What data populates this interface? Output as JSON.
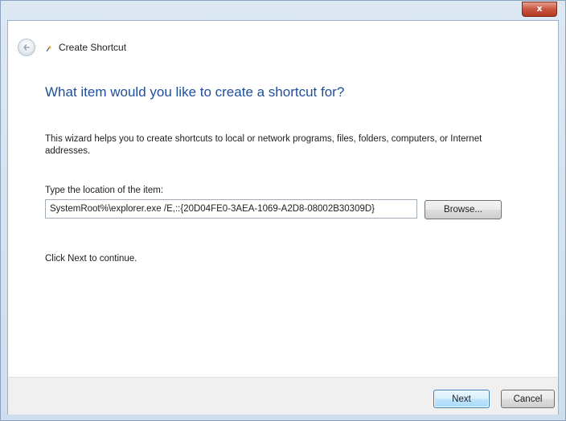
{
  "window": {
    "close_glyph": "x",
    "accent_color": "#1f4e9e",
    "close_button_color": "#c8553f"
  },
  "nav": {
    "title": "Create Shortcut",
    "back_icon": "back-arrow-icon",
    "wizard_icon": "shortcut-wizard-icon"
  },
  "main": {
    "heading": "What item would you like to create a shortcut for?",
    "description": "This wizard helps you to create shortcuts to local or network programs, files, folders, computers, or Internet addresses.",
    "location_label": "Type the location of the item:",
    "location_value": "SystemRoot%\\explorer.exe /E,::{20D04FE0-3AEA-1069-A2D8-08002B30309D}",
    "browse_label": "Browse...",
    "continue_text": "Click Next to continue."
  },
  "footer": {
    "next_label": "Next",
    "cancel_label": "Cancel"
  }
}
